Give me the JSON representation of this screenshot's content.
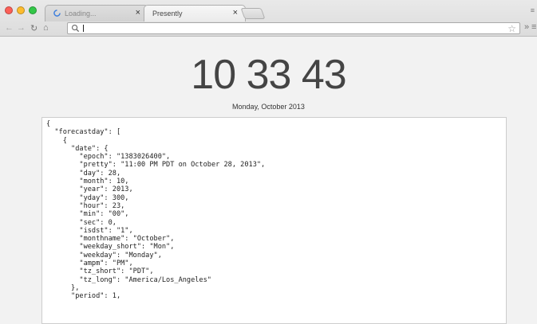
{
  "browser": {
    "tabs": [
      {
        "title": "Loading...",
        "active": false
      },
      {
        "title": "Presently",
        "active": true
      }
    ],
    "address_value": "",
    "window_icon": "person-icon"
  },
  "page": {
    "clock": "10 33 43",
    "date": "Monday, October 2013",
    "json_lines": [
      "{",
      "  \"forecastday\": [",
      "    {",
      "      \"date\": {",
      "        \"epoch\": \"1383026400\",",
      "        \"pretty\": \"11:00 PM PDT on October 28, 2013\",",
      "        \"day\": 28,",
      "        \"month\": 10,",
      "        \"year\": 2013,",
      "        \"yday\": 300,",
      "        \"hour\": 23,",
      "        \"min\": \"00\",",
      "        \"sec\": 0,",
      "        \"isdst\": \"1\",",
      "        \"monthname\": \"October\",",
      "        \"weekday_short\": \"Mon\",",
      "        \"weekday\": \"Monday\",",
      "        \"ampm\": \"PM\",",
      "        \"tz_short\": \"PDT\",",
      "        \"tz_long\": \"America/Los_Angeles\"",
      "      },",
      "      \"period\": 1,"
    ]
  },
  "colors": {
    "close": "#fc5f57",
    "minimize": "#fdbc2e",
    "maximize": "#33c748",
    "clock_text": "#444444"
  }
}
